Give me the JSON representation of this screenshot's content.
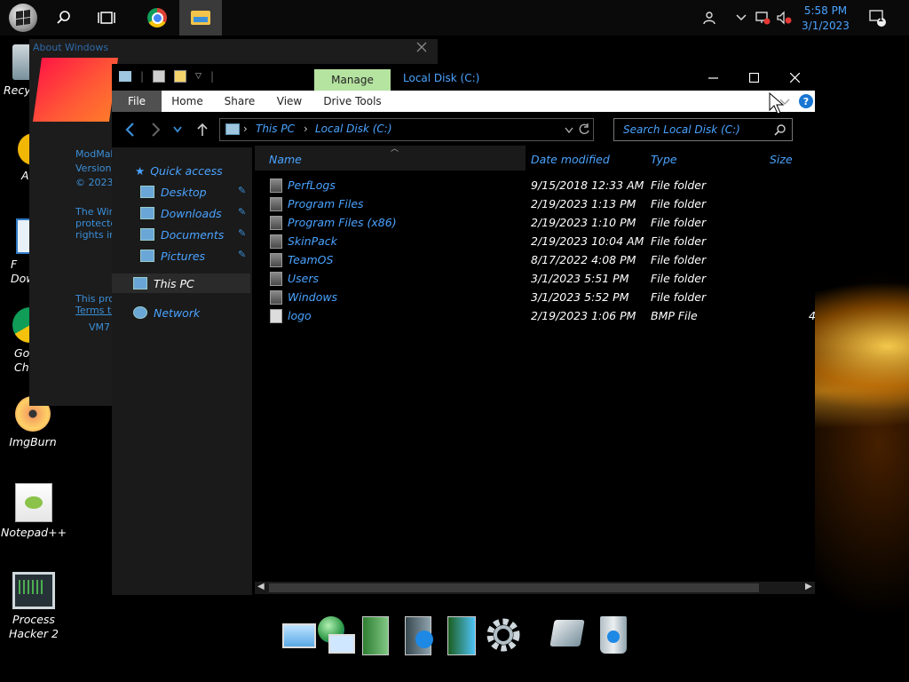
{
  "clock": {
    "time": "5:58 PM",
    "date": "3/1/2023"
  },
  "notifications": {
    "count": "1"
  },
  "desktop_icons": [
    {
      "label": "Recy",
      "icon": "recycle-bin-icon"
    },
    {
      "label": "A",
      "icon": "app-icon"
    },
    {
      "label": "F\nDow",
      "icon": "download-icon"
    },
    {
      "label": "Go\nCh",
      "icon": "chrome-icon"
    },
    {
      "label": "ImgBurn",
      "icon": "disc-icon"
    },
    {
      "label": "Notepad++",
      "icon": "notepad-icon"
    },
    {
      "label": "Process\nHacker 2",
      "icon": "monitor-icon"
    }
  ],
  "about": {
    "title": "About Windows",
    "lines": [
      "ModMak",
      "Version",
      "© 2023",
      "The Win",
      "protecte",
      "rights in",
      "This pro",
      "Terms to",
      "VM7"
    ]
  },
  "explorer": {
    "manage_tab": "Manage",
    "title": "Local Disk (C:)",
    "ribbon_tabs": [
      "File",
      "Home",
      "Share",
      "View",
      "Drive Tools"
    ],
    "breadcrumb": [
      "This PC",
      "Local Disk (C:)"
    ],
    "search_placeholder": "Search Local Disk (C:)",
    "nav": {
      "quick_access": "Quick access",
      "items": [
        "Desktop",
        "Downloads",
        "Documents",
        "Pictures"
      ],
      "this_pc": "This PC",
      "network": "Network"
    },
    "columns": {
      "name": "Name",
      "date": "Date modified",
      "type": "Type",
      "size": "Size"
    },
    "files": [
      {
        "name": "PerfLogs",
        "date": "9/15/2018 12:33 AM",
        "type": "File folder",
        "size": ""
      },
      {
        "name": "Program Files",
        "date": "2/19/2023 1:13 PM",
        "type": "File folder",
        "size": ""
      },
      {
        "name": "Program Files (x86)",
        "date": "2/19/2023 1:10 PM",
        "type": "File folder",
        "size": ""
      },
      {
        "name": "SkinPack",
        "date": "2/19/2023 10:04 AM",
        "type": "File folder",
        "size": ""
      },
      {
        "name": "TeamOS",
        "date": "8/17/2022 4:08 PM",
        "type": "File folder",
        "size": ""
      },
      {
        "name": "Users",
        "date": "3/1/2023 5:51 PM",
        "type": "File folder",
        "size": ""
      },
      {
        "name": "Windows",
        "date": "3/1/2023 5:52 PM",
        "type": "File folder",
        "size": ""
      },
      {
        "name": "logo",
        "date": "2/19/2023 1:06 PM",
        "type": "BMP File",
        "size": "4"
      }
    ]
  },
  "dock": [
    "computer-icon",
    "network-globe-icon",
    "documents-icon",
    "media-player-icon",
    "pictures-icon",
    "settings-gear-icon",
    "control-panel-icon",
    "recycle-bin-icon"
  ]
}
